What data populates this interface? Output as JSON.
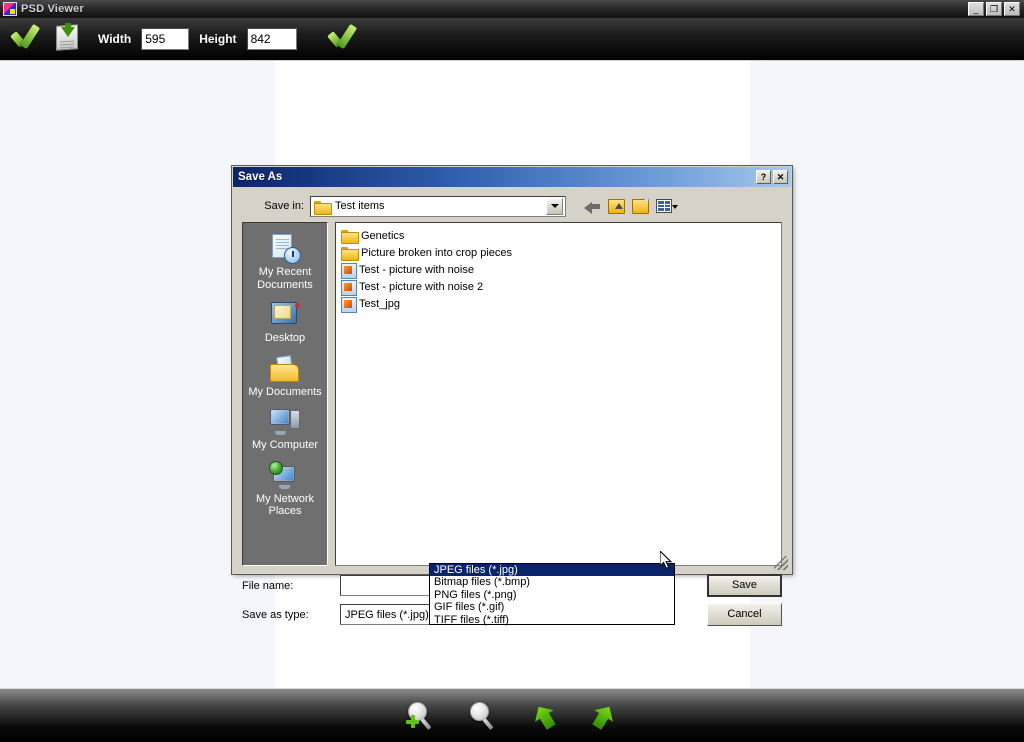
{
  "window": {
    "title": "PSD Viewer",
    "icon": "psd-app-icon",
    "buttons": [
      {
        "name": "minimize",
        "glyph": "_"
      },
      {
        "name": "restore",
        "glyph": "❐"
      },
      {
        "name": "close",
        "glyph": "✕"
      }
    ]
  },
  "toolbar": {
    "apply_icon": "green-check-icon",
    "save_icon": "save-document-icon",
    "width_label": "Width",
    "width_value": "595",
    "height_label": "Height",
    "height_value": "842",
    "confirm_icon": "green-check-icon"
  },
  "bottom_toolbar": {
    "items": [
      {
        "name": "zoom-in-icon",
        "label": "Zoom In"
      },
      {
        "name": "zoom-out-icon",
        "label": "Zoom Out"
      },
      {
        "name": "rotate-left-icon",
        "label": "Rotate Left"
      },
      {
        "name": "rotate-right-icon",
        "label": "Rotate Right"
      }
    ]
  },
  "dialog": {
    "title": "Save As",
    "help_glyph": "?",
    "close_glyph": "✕",
    "save_in_label": "Save in:",
    "save_in_value": "Test items",
    "nav": {
      "back": "back-arrow-icon",
      "up": "up-one-level-icon",
      "new_folder": "new-folder-icon",
      "views": "views-menu-icon"
    },
    "places": [
      {
        "label": "My Recent\nDocuments",
        "icon": "recent-documents-icon"
      },
      {
        "label": "Desktop",
        "icon": "desktop-icon"
      },
      {
        "label": "My Documents",
        "icon": "my-documents-icon"
      },
      {
        "label": "My Computer",
        "icon": "my-computer-icon"
      },
      {
        "label": "My Network\nPlaces",
        "icon": "my-network-places-icon"
      }
    ],
    "files": [
      {
        "name": "Genetics",
        "type": "folder"
      },
      {
        "name": "Picture broken into crop pieces",
        "type": "folder"
      },
      {
        "name": "Test - picture with noise",
        "type": "image"
      },
      {
        "name": "Test - picture with noise 2",
        "type": "image"
      },
      {
        "name": "Test_jpg",
        "type": "image"
      }
    ],
    "file_name_label": "File name:",
    "file_name_value": "",
    "save_as_type_label": "Save as type:",
    "save_as_type_value": "JPEG files (*.jpg)",
    "save_button": "Save",
    "cancel_button": "Cancel",
    "type_options": [
      "JPEG files (*.jpg)",
      "Bitmap files (*.bmp)",
      "PNG files (*.png)",
      "GIF files (*.gif)",
      "TIFF files (*.tiff)"
    ],
    "type_selected_index": 0
  },
  "colors": {
    "dialog_face": "#d6d2c7",
    "title_gradient_start": "#0a246a",
    "title_gradient_end": "#a7c8ea",
    "selection_blue": "#0a246a",
    "places_bar": "#6f6f6f",
    "canvas": "#ffffff",
    "workspace": "#f4f6fb",
    "accent_green": "#63c217"
  }
}
